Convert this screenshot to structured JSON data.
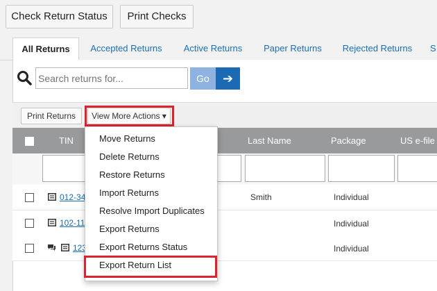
{
  "toolbar": {
    "check_return_status": "Check Return Status",
    "print_checks": "Print Checks"
  },
  "tabs": [
    {
      "label": "All Returns",
      "active": true
    },
    {
      "label": "Accepted Returns"
    },
    {
      "label": "Active Returns"
    },
    {
      "label": "Paper Returns"
    },
    {
      "label": "Rejected Returns"
    },
    {
      "label": "S"
    }
  ],
  "search": {
    "placeholder": "Search returns for...",
    "go_label": "Go",
    "arrow_glyph": "➔"
  },
  "actions": {
    "print_returns": "Print Returns",
    "view_more_actions": "View More Actions ▾"
  },
  "table": {
    "columns": [
      "TIN",
      "Last Name",
      "Package",
      "US e-file"
    ],
    "rows": [
      {
        "tin": "012-34",
        "last_name": "Smith",
        "package": "Individual"
      },
      {
        "tin": "102-11",
        "last_name": "",
        "package": "Individual"
      },
      {
        "tin": "123",
        "last_name": "",
        "package": "Individual"
      }
    ]
  },
  "dropdown": {
    "items": [
      "Move Returns",
      "Delete Returns",
      "Restore Returns",
      "Import Returns",
      "Resolve Import Duplicates",
      "Export Returns",
      "Export Returns Status",
      "Export Return List"
    ]
  },
  "colors": {
    "accent": "#1b6ab3",
    "highlight_border": "#d9232e",
    "table_header": "#999a9c"
  }
}
